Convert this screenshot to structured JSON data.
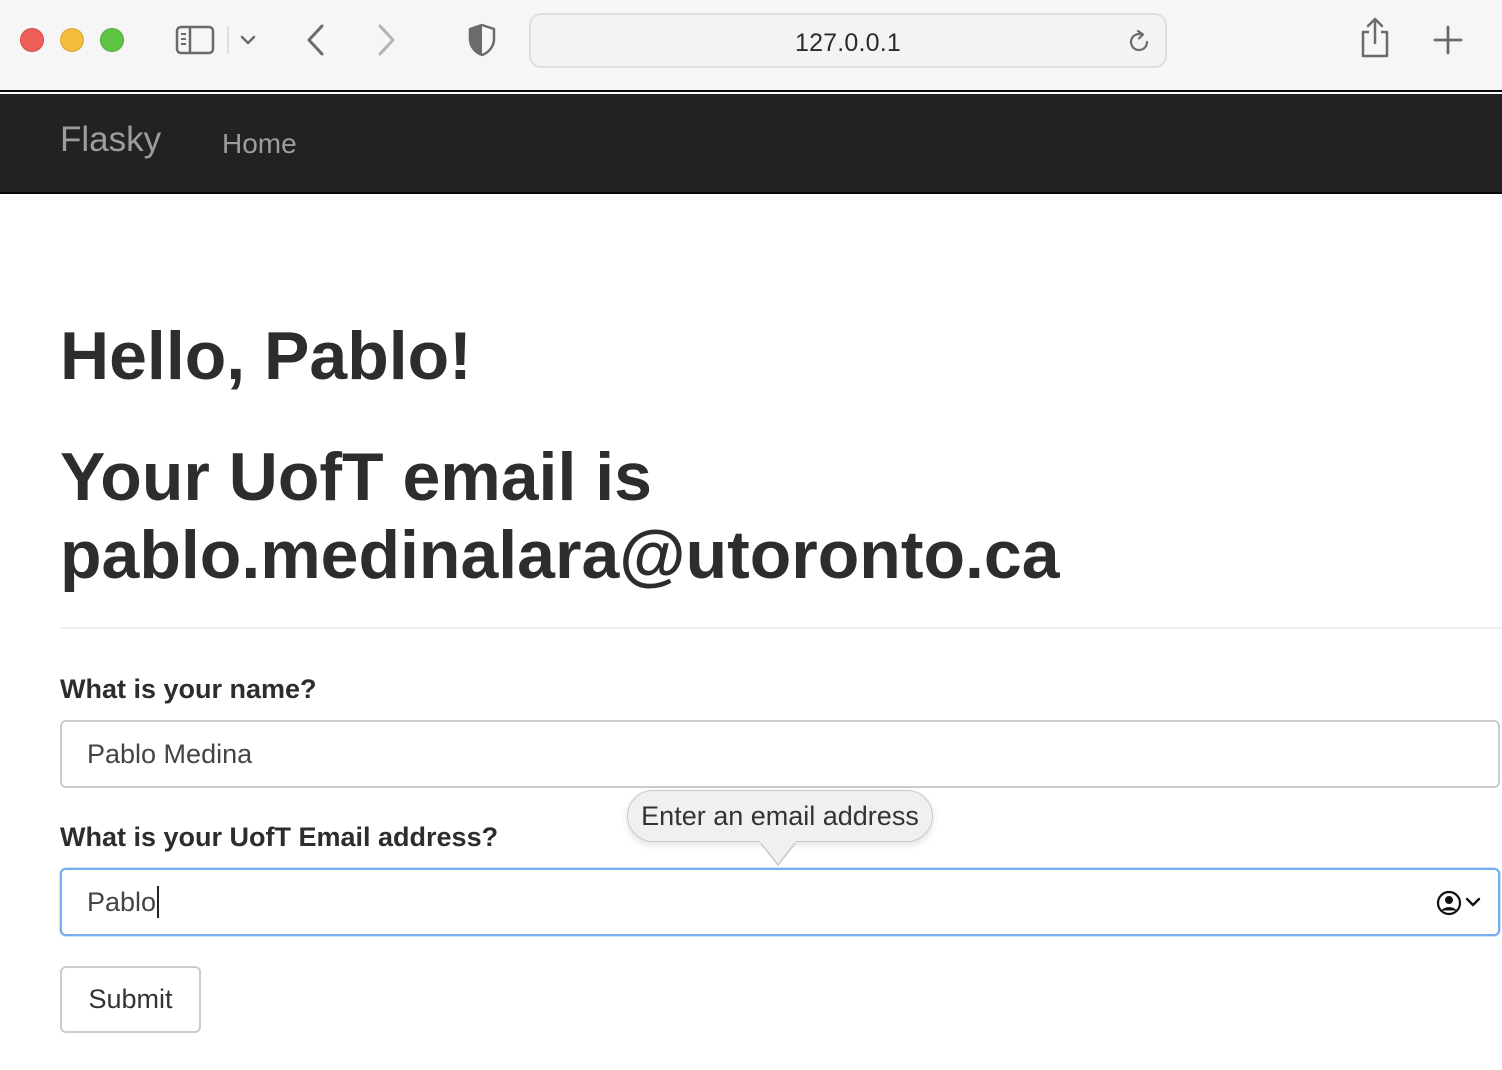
{
  "browser": {
    "url": "127.0.0.1",
    "icons": {
      "close": "red-traffic-light",
      "minimize": "yellow-traffic-light",
      "zoom": "green-traffic-light",
      "sidebar": "sidebar-icon",
      "tab_menu": "chevron-down-icon",
      "back": "chevron-left-icon",
      "forward": "chevron-right-icon",
      "privacy": "shield-icon",
      "reload": "reload-icon",
      "share": "share-icon",
      "new_tab": "plus-icon"
    }
  },
  "navbar": {
    "brand": "Flasky",
    "links": [
      {
        "label": "Home"
      }
    ]
  },
  "main": {
    "greeting": "Hello, Pablo!",
    "email_line1": "Your UofT email is",
    "email_line2": "pablo.medinalara@utoronto.ca"
  },
  "form": {
    "name_label": "What is your name?",
    "name_value": "Pablo Medina",
    "email_label": "What is your UofT Email address?",
    "email_value": "Pablo",
    "submit_label": "Submit",
    "validation_tooltip": "Enter an email address"
  },
  "colors": {
    "navbar_bg": "#222222",
    "navbar_text": "#9d9d9d",
    "focus_border": "#78aef0",
    "heading_text": "#2d2d2d"
  }
}
